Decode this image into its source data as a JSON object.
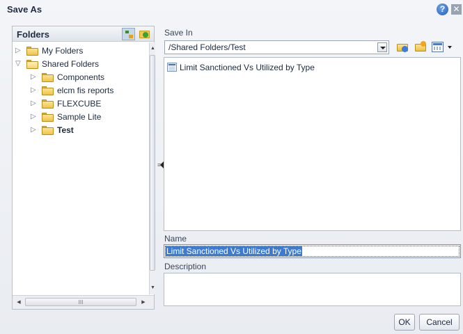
{
  "dialog": {
    "title": "Save As",
    "help_icon": "help-icon",
    "close_icon": "close-icon"
  },
  "folders": {
    "title": "Folders",
    "icons": [
      "tree-view-icon",
      "refresh-folder-icon"
    ],
    "tree": [
      {
        "label": "My Folders",
        "expanded": false,
        "selected": false
      },
      {
        "label": "Shared Folders",
        "expanded": true,
        "selected": false
      },
      {
        "label": "Components",
        "expanded": false,
        "selected": false
      },
      {
        "label": "elcm fis reports",
        "expanded": false,
        "selected": false
      },
      {
        "label": "FLEXCUBE",
        "expanded": false,
        "selected": false
      },
      {
        "label": "Sample Lite",
        "expanded": false,
        "selected": false
      },
      {
        "label": "Test",
        "expanded": false,
        "selected": true
      }
    ],
    "hscroll_grip": "III"
  },
  "save_in": {
    "label": "Save In",
    "value": "/Shared Folders/Test"
  },
  "file_list": {
    "items": [
      {
        "label": "Limit Sanctioned Vs Utilized by Type",
        "icon": "report-icon"
      }
    ]
  },
  "name": {
    "label": "Name",
    "value": "Limit Sanctioned Vs Utilized by Type"
  },
  "description": {
    "label": "Description",
    "value": ""
  },
  "buttons": {
    "ok": "OK",
    "cancel": "Cancel"
  },
  "colors": {
    "selection": "#3d7bd1",
    "folder": "#f1c443",
    "title": "#1f2d44"
  }
}
